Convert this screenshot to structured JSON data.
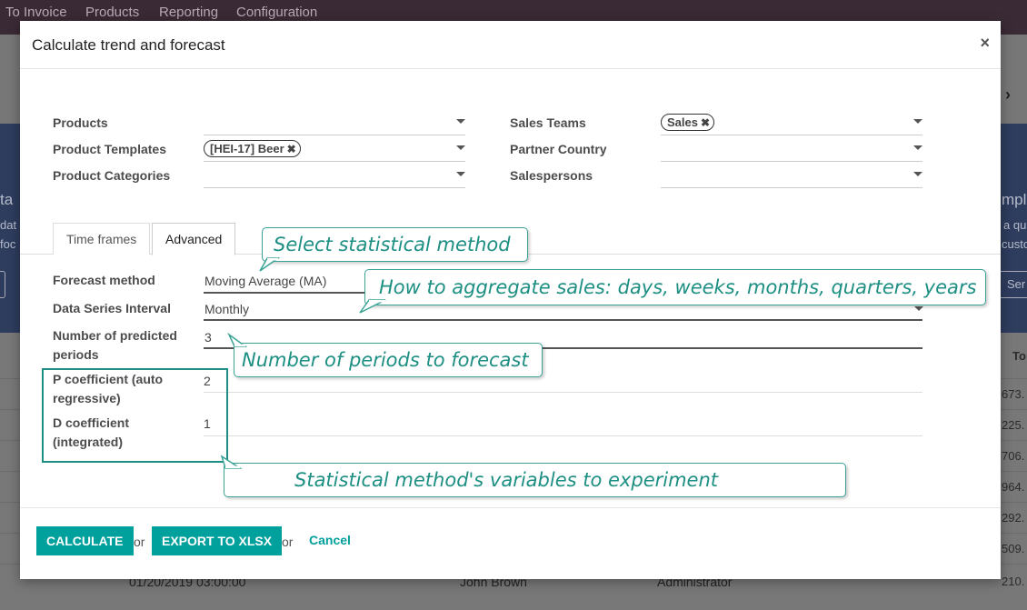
{
  "background": {
    "nav": [
      "To Invoice",
      "Products",
      "Reporting",
      "Configuration"
    ],
    "right_fragments": [
      "mpl",
      "a qu",
      "custo",
      "Ser",
      "To",
      "673.",
      "225.",
      "706.",
      "964.",
      "292.",
      "509.",
      "210."
    ],
    "left_fragments": [
      "ta",
      "dat",
      "foc"
    ],
    "bottom_row": [
      "01/20/2019 03:00:00",
      "John Brown",
      "Administrator"
    ]
  },
  "modal": {
    "title": "Calculate trend and forecast",
    "close_label": "×",
    "filters": {
      "products_label": "Products",
      "product_templates_label": "Product Templates",
      "product_templates_tag": "[HEI-17] Beer",
      "product_categories_label": "Product Categories",
      "sales_teams_label": "Sales Teams",
      "sales_teams_tag": "Sales",
      "partner_country_label": "Partner Country",
      "salespersons_label": "Salespersons"
    },
    "tabs": [
      "Time frames",
      "Advanced"
    ],
    "advanced": {
      "forecast_method_label": "Forecast method",
      "forecast_method_value": "Moving Average (MA)",
      "data_series_label": "Data Series Interval",
      "data_series_value": "Monthly",
      "predicted_label_1": "Number of predicted",
      "predicted_label_2": "periods",
      "predicted_value": "3",
      "p_label_1": "P coefficient (auto",
      "p_label_2": "regressive)",
      "p_value": "2",
      "d_label_1": "D coefficient",
      "d_label_2": "(integrated)",
      "d_value": "1"
    },
    "footer": {
      "calculate": "CALCULATE",
      "or1": "or",
      "export": "EXPORT TO XLSX",
      "or2": "or",
      "cancel": "Cancel"
    }
  },
  "callouts": {
    "method": "Select statistical method",
    "aggregate": "How to aggregate sales: days, weeks, months, quarters, years",
    "periods": "Number of periods to forecast",
    "variables": "Statistical method's variables to experiment"
  },
  "colors": {
    "accent": "#00a09d",
    "callout": "#1d8f83",
    "topbar": "#3a2a35"
  }
}
